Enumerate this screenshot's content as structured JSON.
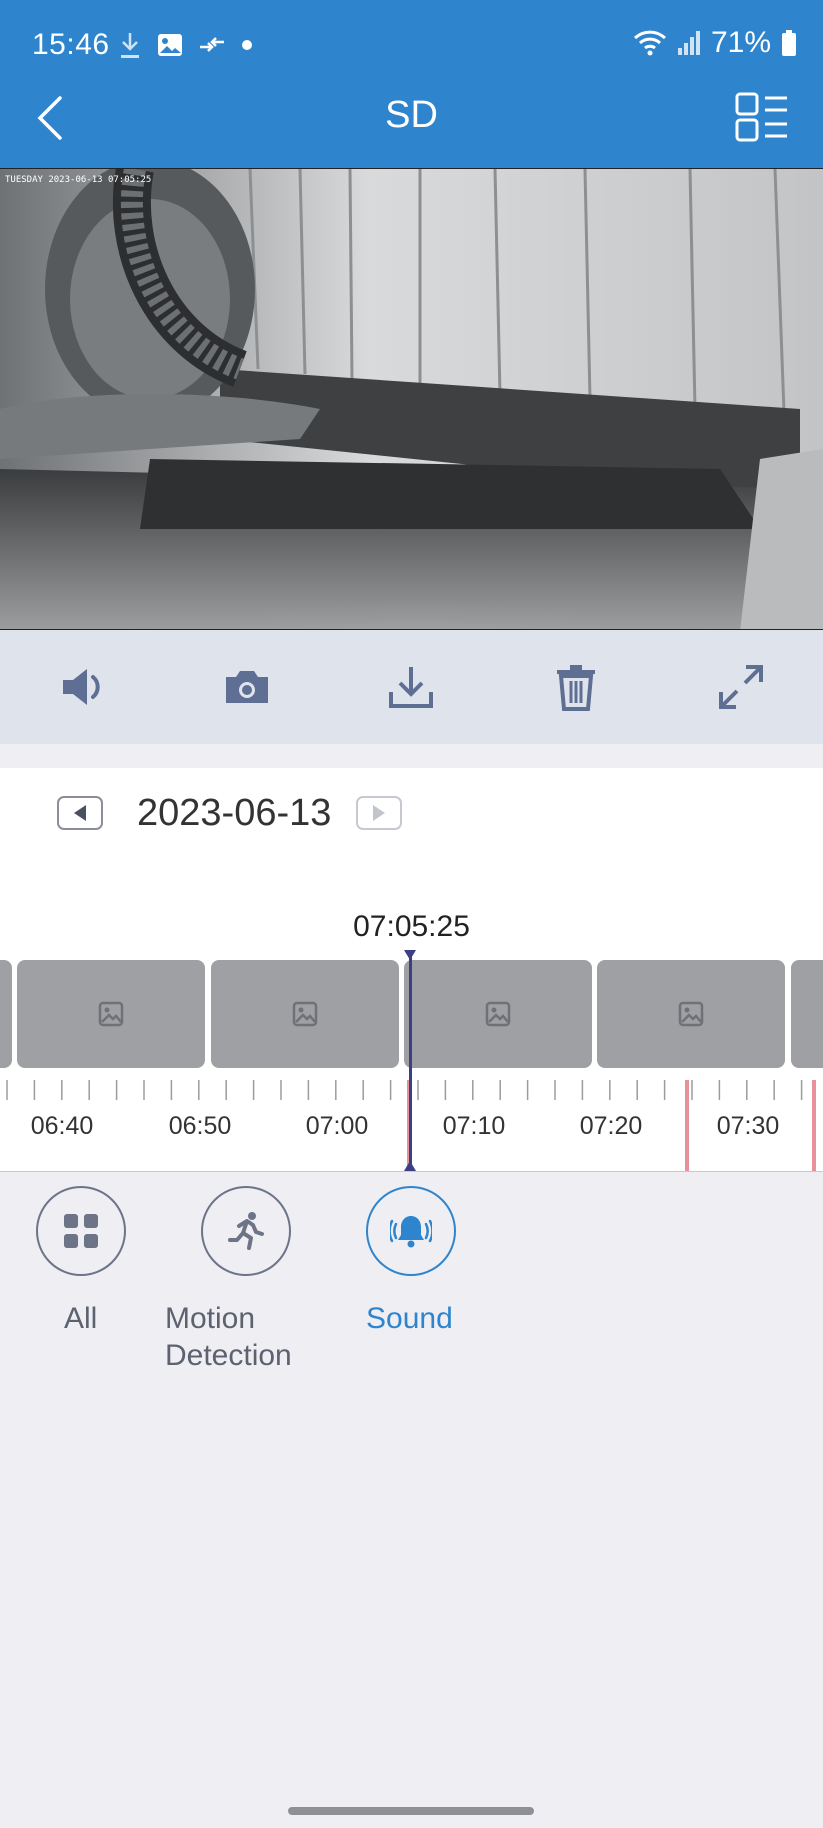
{
  "status_bar": {
    "time": "15:46",
    "battery": "71%",
    "left_icons": [
      "download-icon",
      "image-icon",
      "transfer-icon",
      "dot-icon"
    ],
    "right_icons": [
      "wifi-icon",
      "signal-icon",
      "battery-icon"
    ]
  },
  "app_bar": {
    "title": "SD",
    "back_icon": "chevron-left-icon",
    "menu_icon": "grid-list-icon"
  },
  "video": {
    "overlay_timestamp": "TUESDAY 2023-06-13 07:05:25"
  },
  "toolbar": {
    "items": [
      {
        "name": "volume-icon"
      },
      {
        "name": "camera-icon"
      },
      {
        "name": "download-icon"
      },
      {
        "name": "trash-icon"
      },
      {
        "name": "fullscreen-icon"
      }
    ]
  },
  "date_nav": {
    "date": "2023-06-13",
    "current_time": "07:05:25"
  },
  "timeline": {
    "tick_labels": [
      "06:40",
      "06:50",
      "07:00",
      "07:10",
      "07:20",
      "07:30"
    ],
    "thumbnail_icon": "image-placeholder-icon"
  },
  "filters": {
    "all": "All",
    "motion_line1": "Motion",
    "motion_line2": "Detection",
    "sound": "Sound",
    "active": "Sound"
  },
  "colors": {
    "brand_blue": "#2f85cd",
    "event_marker": "#e8919a",
    "cursor": "#3c3f86"
  }
}
